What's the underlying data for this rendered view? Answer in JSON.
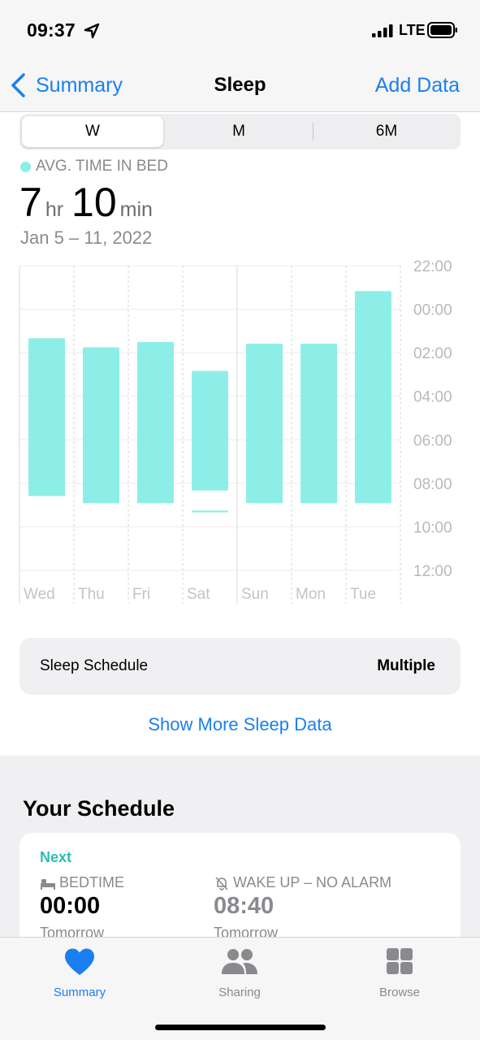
{
  "status_bar": {
    "time": "09:37",
    "network": "LTE"
  },
  "nav": {
    "back_label": "Summary",
    "title": "Sleep",
    "action_label": "Add Data"
  },
  "segments": {
    "items": [
      "W",
      "M",
      "6M"
    ],
    "selected": "W"
  },
  "summary": {
    "label": "AVG. TIME IN BED",
    "hours": "7",
    "hours_unit": "hr",
    "minutes": "10",
    "minutes_unit": "min",
    "date_range": "Jan 5 – 11, 2022"
  },
  "chart_data": {
    "type": "bar",
    "categories": [
      "Wed",
      "Thu",
      "Fri",
      "Sat",
      "Sun",
      "Mon",
      "Tue"
    ],
    "series": [
      {
        "name": "In Bed",
        "color": "#8deee8",
        "start": [
          "01:20",
          "01:45",
          "01:30",
          "02:50",
          "01:35",
          "01:35",
          "23:10"
        ],
        "end": [
          "08:35",
          "08:55",
          "08:55",
          "08:20",
          "08:55",
          "08:55",
          "08:55"
        ]
      }
    ],
    "extra_segments": [
      {
        "category": "Sat",
        "start": "09:15",
        "end": "09:20"
      }
    ],
    "y_ticks": [
      "22:00",
      "00:00",
      "02:00",
      "04:00",
      "06:00",
      "08:00",
      "10:00",
      "12:00"
    ],
    "y_range": [
      "22:00",
      "12:00"
    ],
    "grid": true
  },
  "sleep_schedule": {
    "label": "Sleep Schedule",
    "value": "Multiple"
  },
  "show_more": "Show More Sleep Data",
  "schedule": {
    "title": "Your Schedule",
    "next_label": "Next",
    "bedtime": {
      "label": "BEDTIME",
      "time": "00:00",
      "day": "Tomorrow"
    },
    "wakeup": {
      "label": "WAKE UP – NO ALARM",
      "time": "08:40",
      "day": "Tomorrow"
    }
  },
  "tabs": [
    {
      "label": "Summary",
      "icon": "heart-icon",
      "active": true
    },
    {
      "label": "Sharing",
      "icon": "people-icon",
      "active": false
    },
    {
      "label": "Browse",
      "icon": "grid-icon",
      "active": false
    }
  ],
  "colors": {
    "accent": "#1a7ff0",
    "sleep": "#8deee8",
    "teal_text": "#2bbfb3"
  }
}
